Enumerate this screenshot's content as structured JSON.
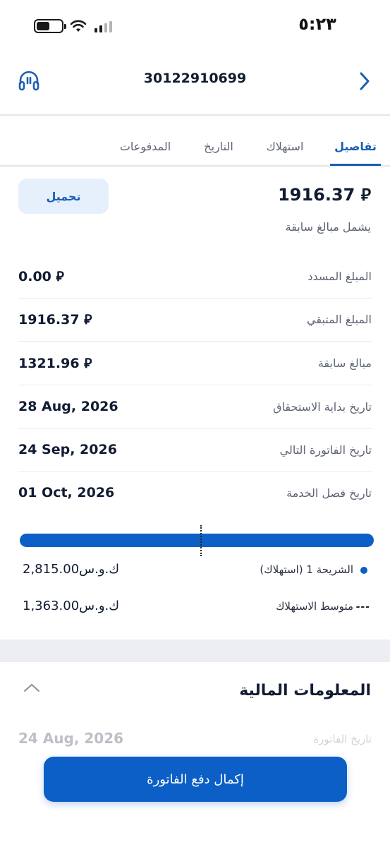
{
  "status_bar": {
    "time": "٥:٢٣"
  },
  "header": {
    "account_number": "30122910699",
    "support_icon": "headset-icon",
    "back_icon": "chevron-right-icon"
  },
  "tabs": [
    {
      "label": "تفاصيل",
      "active": true
    },
    {
      "label": "استهلاك",
      "active": false
    },
    {
      "label": "التاريخ",
      "active": false
    },
    {
      "label": "المدفوعات",
      "active": false
    }
  ],
  "bill": {
    "total_amount": "1916.37 ⃁",
    "includes_note": "يشمل مبالغ سابقة",
    "download_label": "تحميل"
  },
  "details": [
    {
      "label": "المبلغ المسدد",
      "value": "0.00 ⃁"
    },
    {
      "label": "المبلغ المتبقي",
      "value": "1916.37 ⃁"
    },
    {
      "label": "مبالغ سابقة",
      "value": "1321.96 ⃁"
    },
    {
      "label": "تاريخ بداية الاستحقاق",
      "value": "28 Aug, 2026"
    },
    {
      "label": "تاريخ الفاتورة التالي",
      "value": "24 Sep, 2026"
    },
    {
      "label": "تاريخ فصل الخدمة",
      "value": "01 Oct, 2026"
    }
  ],
  "usage": {
    "average_marker_fraction": 0.51,
    "legend": [
      {
        "label": "الشريحة 1 (استهلاك)",
        "value": "2,815.00ك.و.س",
        "marker": "dot"
      },
      {
        "label": "متوسط الاستهلاك",
        "value": "1,363.00ك.و.س",
        "marker": "dash"
      }
    ]
  },
  "financial_info": {
    "title": "المعلومات المالية",
    "collapse_icon": "chevron-up-icon",
    "first_row_label": "تاريخ الفاتورة",
    "first_row_value": "24 Aug, 2026"
  },
  "pay_button_label": "إكمال دفع الفاتورة",
  "colors": {
    "primary": "#0c5fc6",
    "accent_tab": "#1a5fb4",
    "download_bg": "#e5f0fc",
    "divider_bg": "#eceef2"
  }
}
